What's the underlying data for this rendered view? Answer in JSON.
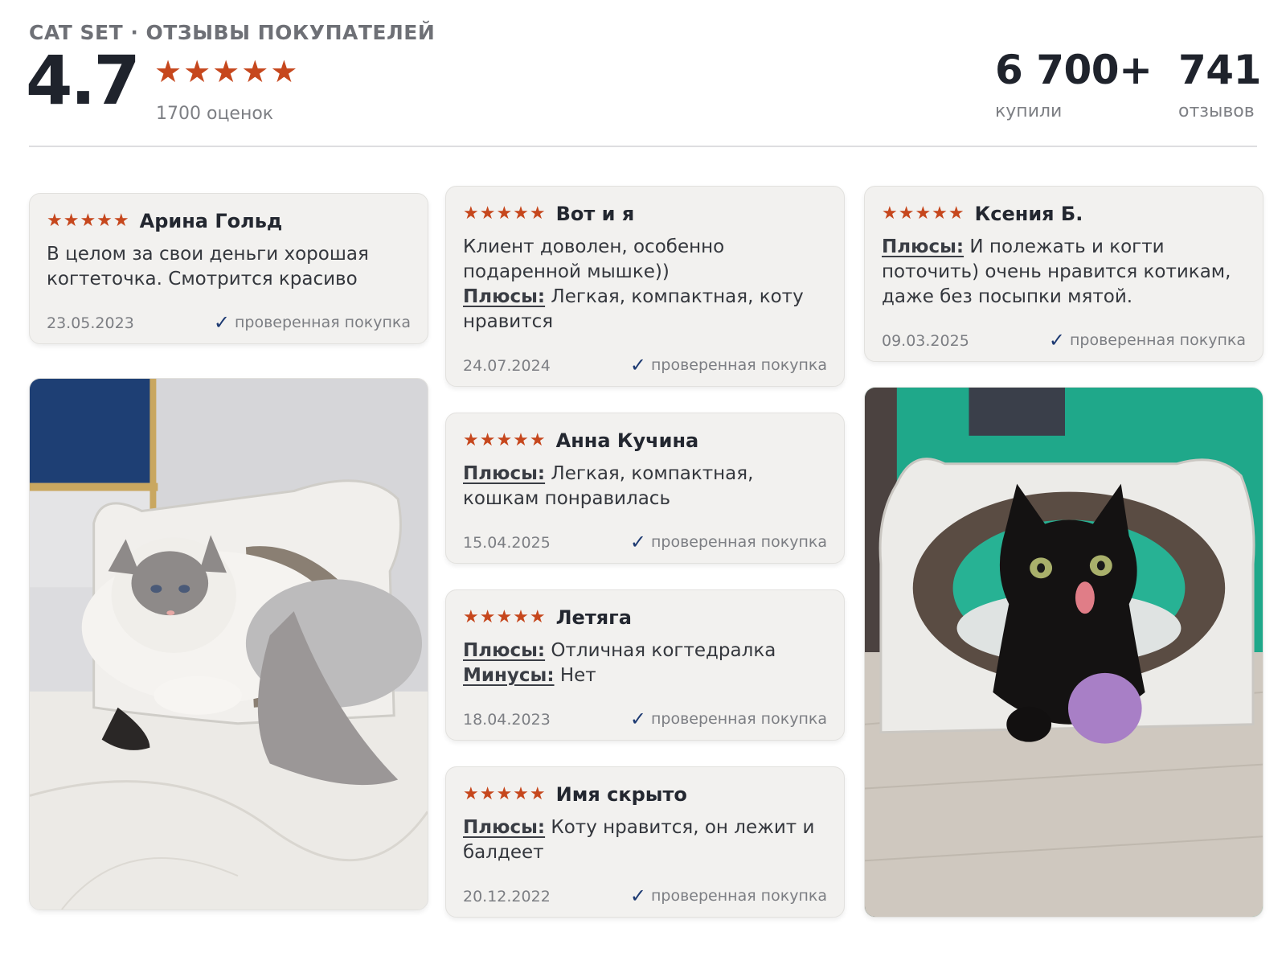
{
  "header": {
    "brand": "CAT SET · ОТЗЫВЫ ПОКУПАТЕЛЕЙ",
    "score": "4.7",
    "ratings_count": "1700 оценок",
    "bought_value": "6 700+",
    "bought_label": "купили",
    "reviews_value": "741",
    "reviews_label": "отзывов",
    "star": "★"
  },
  "colors": {
    "accent": "#c6471d",
    "check": "#1d3a72",
    "card_bg": "#f2f1ef"
  },
  "labels": {
    "pros": "Плюсы:",
    "cons": "Минусы:",
    "verified": "проверенная покупка",
    "stars": "★★★★★",
    "check": "✓"
  },
  "reviews": [
    {
      "author": "Арина Гольд",
      "text": "В целом за свои деньги хорошая когтеточка. Смотрится красиво",
      "date": "23.05.2023"
    },
    {
      "author": "Вот и я",
      "text": "Клиент доволен, особенно подаренной мышке))",
      "pros": "Легкая, компактная, коту нравится",
      "date": "24.07.2024"
    },
    {
      "author": "Ксения Б.",
      "pros": "И полежать и когти поточить) очень нравится котикам, даже без посыпки мятой.",
      "date": "09.03.2025"
    },
    {
      "author": "Анна Кучина",
      "pros": "Легкая, компактная, кошкам понравилась",
      "date": "15.04.2025"
    },
    {
      "author": "Летяга",
      "pros": "Отличная когтедралка",
      "cons": "Нет",
      "date": "18.04.2023"
    },
    {
      "author": "Имя скрыто",
      "pros": "Коту нравится, он лежит и балдеет",
      "date": "20.12.2022"
    }
  ],
  "photos": [
    {
      "icon": "fluffy-cat-photo-icon"
    },
    {
      "icon": "black-cat-photo-icon"
    }
  ]
}
